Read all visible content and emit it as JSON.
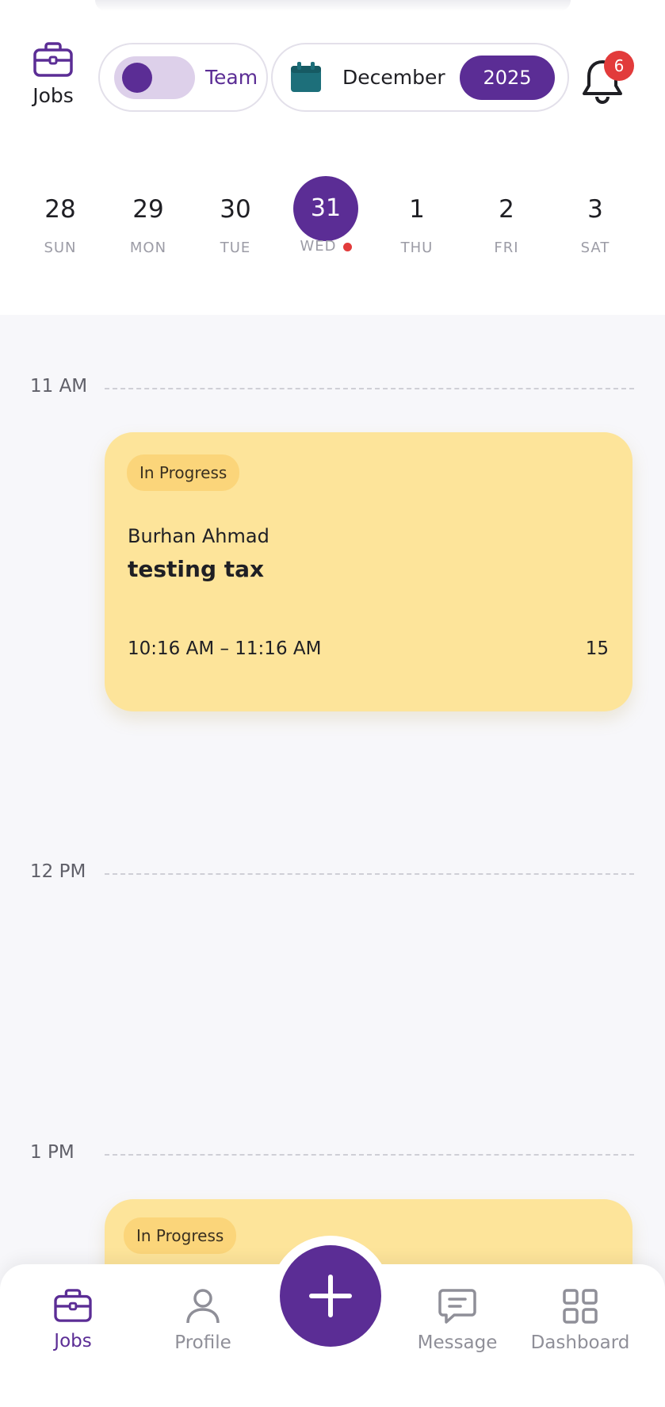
{
  "header": {
    "jobs_label": "Jobs",
    "team_label": "Team",
    "month": "December",
    "year": "2025",
    "notification_count": "6"
  },
  "week": [
    {
      "num": "28",
      "day": "SUN",
      "selected": false,
      "has_dot": false
    },
    {
      "num": "29",
      "day": "MON",
      "selected": false,
      "has_dot": false
    },
    {
      "num": "30",
      "day": "TUE",
      "selected": false,
      "has_dot": false
    },
    {
      "num": "31",
      "day": "WED",
      "selected": true,
      "has_dot": true
    },
    {
      "num": "1",
      "day": "THU",
      "selected": false,
      "has_dot": false
    },
    {
      "num": "2",
      "day": "FRI",
      "selected": false,
      "has_dot": false
    },
    {
      "num": "3",
      "day": "SAT",
      "selected": false,
      "has_dot": false
    }
  ],
  "timeline": {
    "slots": [
      "11 AM",
      "12 PM",
      "1 PM"
    ]
  },
  "jobs": [
    {
      "status": "In Progress",
      "client": "Burhan Ahmad",
      "title": "testing tax",
      "time_range": "10:16 AM – 11:16 AM",
      "count": "15"
    },
    {
      "status": "In Progress"
    }
  ],
  "nav": {
    "jobs": "Jobs",
    "profile": "Profile",
    "message": "Message",
    "dashboard": "Dashboard"
  },
  "colors": {
    "primary": "#5b2d95",
    "card": "#fde49a",
    "status_chip": "#fbd57a",
    "badge": "#e23b3b",
    "calendar_icon": "#1d6f7a"
  },
  "icons": {
    "jobs": "briefcase-icon",
    "calendar": "calendar-icon",
    "notifications": "bell-icon",
    "profile": "person-icon",
    "add": "plus-icon",
    "message": "chat-bubble-icon",
    "dashboard": "grid-icon"
  }
}
